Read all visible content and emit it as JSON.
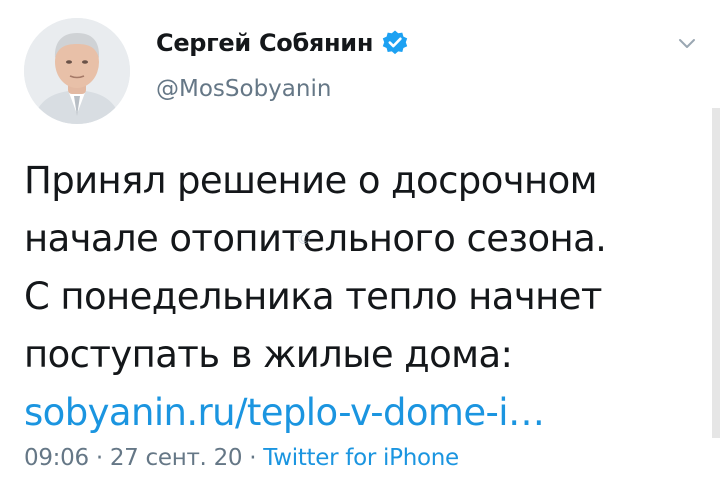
{
  "author": {
    "display_name": "Сергей Собянин",
    "handle": "@MosSobyanin",
    "verified": true
  },
  "tweet": {
    "lines": [
      "Принял решение о досрочном",
      "начале отопительного сезона.",
      "С понедельника тепло начнет",
      "поступать в жилые дома:"
    ],
    "link": "sobyanin.ru/teplo-v-dome-i…"
  },
  "meta": {
    "time": "09:06",
    "separator": "·",
    "date": "27 сент. 20",
    "source": "Twitter for iPhone"
  },
  "colors": {
    "link": "#1b95e0",
    "secondary_text": "#657786",
    "primary_text": "#14171a",
    "verified_badge": "#1da1f2"
  },
  "icons": {
    "verified": "verified-badge-icon",
    "menu": "chevron-down-icon"
  }
}
